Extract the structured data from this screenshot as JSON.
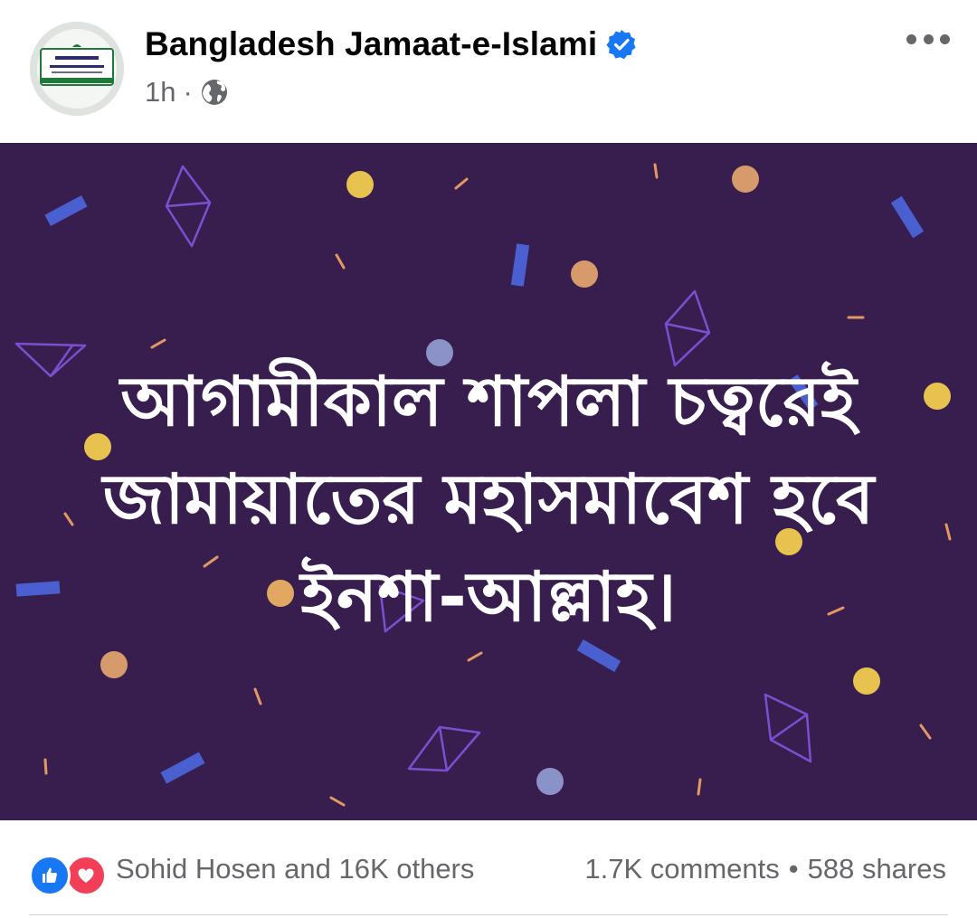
{
  "post": {
    "author": "Bangladesh Jamaat-e-Islami",
    "verified": true,
    "time": "1h",
    "separator": "·",
    "privacy_icon": "globe-icon",
    "more_icon": "more-horizontal-icon"
  },
  "image": {
    "background_color": "#381e4e",
    "text_lines": [
      "আগামীকাল শাপলা চত্বরেই",
      "জামায়াতের মহাসমাবেশ হবে",
      "ইনশা-আল্লাহ।"
    ],
    "text_color": "#ffffff"
  },
  "footer": {
    "reaction_icons": [
      "like-icon",
      "love-icon"
    ],
    "reactions_text": "Sohid Hosen and 16K others",
    "comments": "1.7K comments",
    "separator": "•",
    "shares": "588 shares"
  },
  "colors": {
    "verified_blue": "#1877f2",
    "secondary_text": "#65676b",
    "love_red": "#f33e58"
  }
}
